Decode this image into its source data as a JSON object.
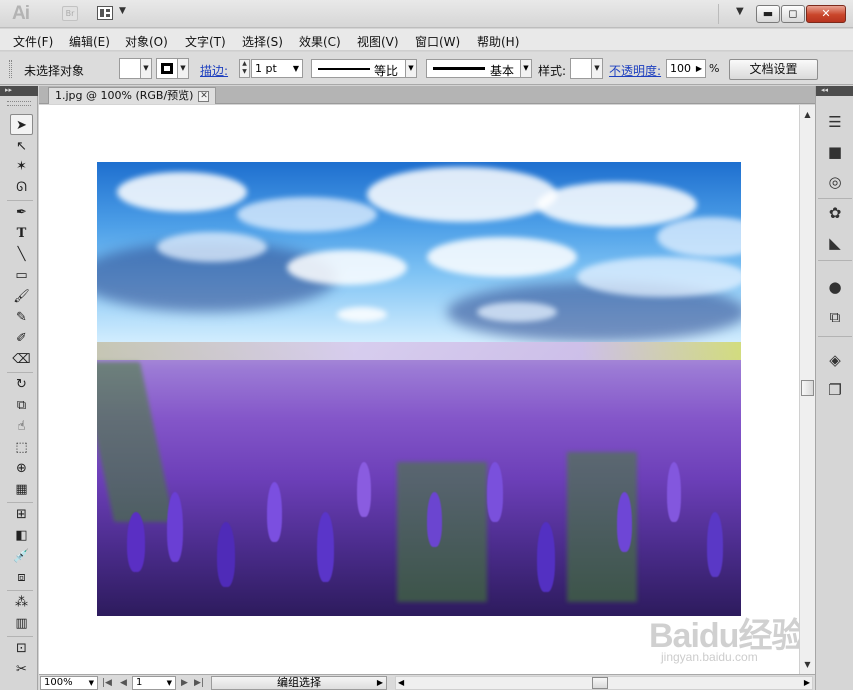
{
  "app": {
    "logo": "Ai",
    "bridge_label": "Br",
    "window_buttons": {
      "minimize": "▬",
      "maximize": "◻",
      "close": "✕"
    }
  },
  "menu": {
    "items": [
      "文件(F)",
      "编辑(E)",
      "对象(O)",
      "文字(T)",
      "选择(S)",
      "效果(C)",
      "视图(V)",
      "窗口(W)",
      "帮助(H)"
    ]
  },
  "control_bar": {
    "selection_label": "未选择对象",
    "stroke_label": "描边:",
    "stroke_weight": "1 pt",
    "profile_label": "等比",
    "brush_label": "基本",
    "style_label": "样式:",
    "opacity_label": "不透明度:",
    "opacity_value": "100",
    "opacity_unit": "%",
    "doc_setup_label": "文档设置"
  },
  "document": {
    "tab_title": "1.jpg @ 100% (RGB/预览)",
    "tab_close": "✕"
  },
  "toolbox": {
    "collapse_label": "▸▸",
    "tools": [
      "selection",
      "direct-selection",
      "magic-wand",
      "lasso",
      "pen",
      "type",
      "line",
      "rectangle",
      "paintbrush",
      "pencil",
      "blob-brush",
      "eraser",
      "rotate",
      "scale",
      "warp",
      "free-transform",
      "shape-builder",
      "perspective-grid",
      "mesh",
      "gradient",
      "eyedropper",
      "blend",
      "symbol-sprayer",
      "column-graph",
      "artboard",
      "slice"
    ]
  },
  "right_dock": {
    "collapse_label": "◂◂",
    "panels": [
      "stroke",
      "gradient",
      "transparency",
      "color-guide",
      "swatches",
      "appearance",
      "graphic-styles",
      "layers",
      "artboards"
    ]
  },
  "status_bar": {
    "zoom": "100%",
    "page": "1",
    "status_text": "编组选择"
  },
  "watermark": {
    "main": "Baidu经验",
    "sub": "jingyan.baidu.com"
  },
  "colors": {
    "chrome": "#d6d6d6",
    "close_button": "#c9452a",
    "link_blue": "#1d3fbf",
    "canvas": "#ffffff"
  }
}
